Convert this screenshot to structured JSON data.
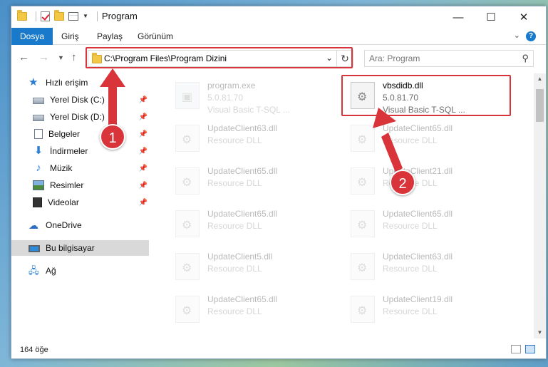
{
  "window": {
    "title": "Program",
    "controls": {
      "minimize": "—",
      "maximize": "☐",
      "close": "✕"
    }
  },
  "ribbon": {
    "tabs": [
      {
        "label": "Dosya",
        "active": true
      },
      {
        "label": "Giriş",
        "active": false
      },
      {
        "label": "Paylaş",
        "active": false
      },
      {
        "label": "Görünüm",
        "active": false
      }
    ],
    "help": "?"
  },
  "nav": {
    "address": "C:\\Program Files\\Program Dizini",
    "search_placeholder": "Ara: Program"
  },
  "sidebar": {
    "items": [
      {
        "label": "Hızlı erişim",
        "icon": "star-icon",
        "pinned": false
      },
      {
        "label": "Yerel Disk (C:)",
        "icon": "disk-icon",
        "pinned": true
      },
      {
        "label": "Yerel Disk (D:)",
        "icon": "disk-icon",
        "pinned": true
      },
      {
        "label": "Belgeler",
        "icon": "document-icon",
        "pinned": true
      },
      {
        "label": "İndirmeler",
        "icon": "download-icon",
        "pinned": true
      },
      {
        "label": "Müzik",
        "icon": "music-icon",
        "pinned": true
      },
      {
        "label": "Resimler",
        "icon": "picture-icon",
        "pinned": true
      },
      {
        "label": "Videolar",
        "icon": "video-icon",
        "pinned": true
      },
      {
        "label": "OneDrive",
        "icon": "cloud-icon",
        "pinned": false
      },
      {
        "label": "Bu bilgisayar",
        "icon": "computer-icon",
        "pinned": false,
        "selected": true
      },
      {
        "label": "Ağ",
        "icon": "network-icon",
        "pinned": false
      }
    ]
  },
  "files": [
    {
      "name": "program.exe",
      "line2": "5.0.81.70",
      "line3": "Visual Basic T-SQL ...",
      "highlighted": false,
      "kind": "exe"
    },
    {
      "name": "vbsdidb.dll",
      "line2": "5.0.81.70",
      "line3": "Visual Basic T-SQL ...",
      "highlighted": true,
      "kind": "dll"
    },
    {
      "name": "UpdateClient63.dll",
      "line2": "Resource DLL",
      "line3": "",
      "highlighted": false,
      "kind": "dll"
    },
    {
      "name": "UpdateClient65.dll",
      "line2": "Resource DLL",
      "line3": "",
      "highlighted": false,
      "kind": "dll"
    },
    {
      "name": "UpdateClient65.dll",
      "line2": "Resource DLL",
      "line3": "",
      "highlighted": false,
      "kind": "dll"
    },
    {
      "name": "UpdateClient21.dll",
      "line2": "Resource DLL",
      "line3": "",
      "highlighted": false,
      "kind": "dll"
    },
    {
      "name": "UpdateClient65.dll",
      "line2": "Resource DLL",
      "line3": "",
      "highlighted": false,
      "kind": "dll"
    },
    {
      "name": "UpdateClient65.dll",
      "line2": "Resource DLL",
      "line3": "",
      "highlighted": false,
      "kind": "dll"
    },
    {
      "name": "UpdateClient5.dll",
      "line2": "Resource DLL",
      "line3": "",
      "highlighted": false,
      "kind": "dll"
    },
    {
      "name": "UpdateClient63.dll",
      "line2": "Resource DLL",
      "line3": "",
      "highlighted": false,
      "kind": "dll"
    },
    {
      "name": "UpdateClient65.dll",
      "line2": "Resource DLL",
      "line3": "",
      "highlighted": false,
      "kind": "dll"
    },
    {
      "name": "UpdateClient19.dll",
      "line2": "Resource DLL",
      "line3": "",
      "highlighted": false,
      "kind": "dll"
    }
  ],
  "status": {
    "item_count": "164 öğe"
  },
  "annotations": {
    "step1": "1",
    "step2": "2"
  },
  "colors": {
    "accent": "#1979ca",
    "annotation": "#d9343a"
  }
}
